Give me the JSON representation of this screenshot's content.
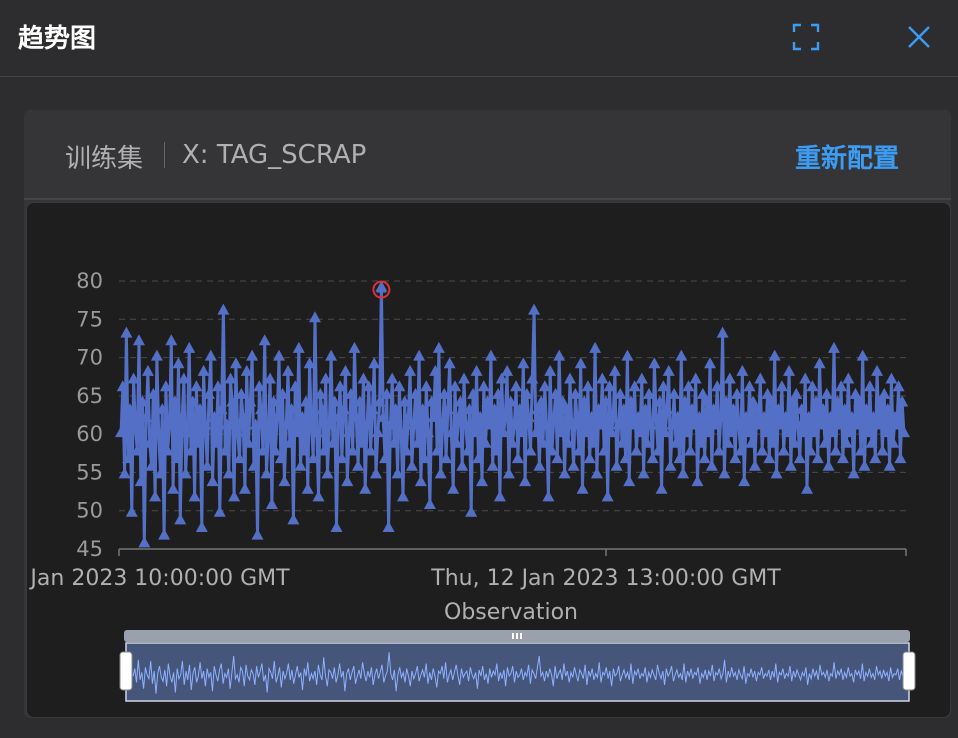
{
  "dialog": {
    "title": "趋势图"
  },
  "icons": {
    "fullscreen": "fullscreen-icon",
    "close": "close-icon"
  },
  "card": {
    "dataset_label": "训练集",
    "x_label": "X: TAG_SCRAP",
    "reconfigure_label": "重新配置"
  },
  "colors": {
    "accent": "#3b9cf2",
    "series": "#5470c6",
    "highlight": "#e03131",
    "background": "#1e1e1f"
  },
  "chart_data": {
    "type": "line",
    "xlabel": "Observation",
    "ylabel": "",
    "ylim": [
      45,
      80
    ],
    "y_ticks": [
      45,
      50,
      55,
      60,
      65,
      70,
      75,
      80
    ],
    "x_tick_labels": [
      "Jan 2023 10:00:00 GMT",
      "Thu, 12 Jan 2023 13:00:00 GMT"
    ],
    "grid": true,
    "series": [
      {
        "marker": "triangle",
        "values": [
          60,
          66,
          55,
          73,
          57,
          63,
          50,
          67,
          61,
          58,
          72,
          54,
          64,
          46,
          62,
          68,
          59,
          56,
          65,
          52,
          70,
          60,
          55,
          63,
          47,
          66,
          58,
          61,
          72,
          53,
          64,
          57,
          69,
          49,
          62,
          67,
          55,
          60,
          71,
          58,
          64,
          52,
          66,
          59,
          63,
          48,
          68,
          61,
          56,
          65,
          70,
          54,
          62,
          59,
          66,
          50,
          63,
          76,
          58,
          61,
          55,
          67,
          64,
          52,
          69,
          60,
          57,
          65,
          62,
          53,
          68,
          59,
          64,
          70,
          56,
          61,
          47,
          66,
          63,
          58,
          72,
          55,
          60,
          67,
          51,
          64,
          58,
          62,
          70,
          57,
          65,
          54,
          61,
          68,
          59,
          63,
          49,
          66,
          60,
          71,
          56,
          62,
          58,
          64,
          53,
          69,
          61,
          57,
          75,
          60,
          52,
          65,
          63,
          58,
          67,
          55,
          61,
          70,
          59,
          64,
          48,
          62,
          66,
          57,
          63,
          68,
          54,
          60,
          65,
          58,
          71,
          62,
          56,
          64,
          59,
          67,
          53,
          61,
          66,
          58,
          63,
          69,
          55,
          60,
          64,
          79,
          62,
          57,
          65,
          48,
          61,
          67,
          59,
          63,
          55,
          66,
          60,
          52,
          64,
          58,
          62,
          68,
          56,
          61,
          65,
          59,
          70,
          54,
          63,
          57,
          66,
          60,
          51,
          64,
          62,
          68,
          58,
          71,
          55,
          61,
          65,
          57,
          63,
          69,
          60,
          53,
          66,
          59,
          62,
          64,
          56,
          67,
          61,
          58,
          63,
          50,
          65,
          60,
          68,
          57,
          62,
          54,
          66,
          59,
          64,
          61,
          70,
          56,
          63,
          58,
          65,
          52,
          67,
          60,
          62,
          68,
          55,
          64,
          59,
          61,
          66,
          57,
          63,
          60,
          69,
          54,
          65,
          62,
          58,
          67,
          76,
          60,
          63,
          56,
          64,
          59,
          66,
          61,
          52,
          68,
          58,
          62,
          65,
          57,
          70,
          60,
          64,
          55,
          63,
          59,
          67,
          61,
          56,
          65,
          62,
          58,
          69,
          53,
          64,
          60,
          66,
          57,
          62,
          59,
          71,
          55,
          63,
          61,
          67,
          58,
          64,
          52,
          66,
          60,
          62,
          68,
          56,
          61,
          65,
          59,
          63,
          57,
          70,
          54,
          64,
          61,
          66,
          58,
          62,
          60,
          67,
          55,
          63,
          59,
          65,
          61,
          57,
          69,
          62,
          58,
          64,
          53,
          66,
          60,
          63,
          68,
          56,
          61,
          65,
          59,
          62,
          57,
          70,
          55,
          64,
          60,
          66,
          58,
          63,
          61,
          67,
          54,
          62,
          59,
          65,
          57,
          64,
          60,
          69,
          56,
          63,
          61,
          66,
          58,
          62,
          73,
          55,
          64,
          59,
          67,
          60,
          63,
          57,
          65,
          61,
          58,
          68,
          54,
          62,
          60,
          66,
          59,
          64,
          56,
          63,
          61,
          67,
          58,
          62,
          60,
          65,
          57,
          64,
          59,
          70,
          55,
          63,
          61,
          66,
          58,
          62,
          60,
          68,
          56,
          64,
          59,
          65,
          61,
          57,
          63,
          60,
          67,
          53,
          62,
          58,
          66,
          60,
          64,
          57,
          69,
          61,
          63,
          59,
          65,
          56,
          62,
          60,
          71,
          58,
          64,
          61,
          66,
          57,
          63,
          59,
          67,
          60,
          62,
          55,
          65,
          61,
          64,
          58,
          70,
          56,
          63,
          60,
          66,
          59,
          62,
          57,
          68,
          61,
          64,
          58,
          65,
          60,
          63,
          56,
          67,
          59,
          62,
          61,
          66,
          57,
          64,
          60
        ]
      }
    ],
    "highlight": {
      "value": 79,
      "label": "max"
    },
    "data_zoom": {
      "range": "full"
    }
  }
}
